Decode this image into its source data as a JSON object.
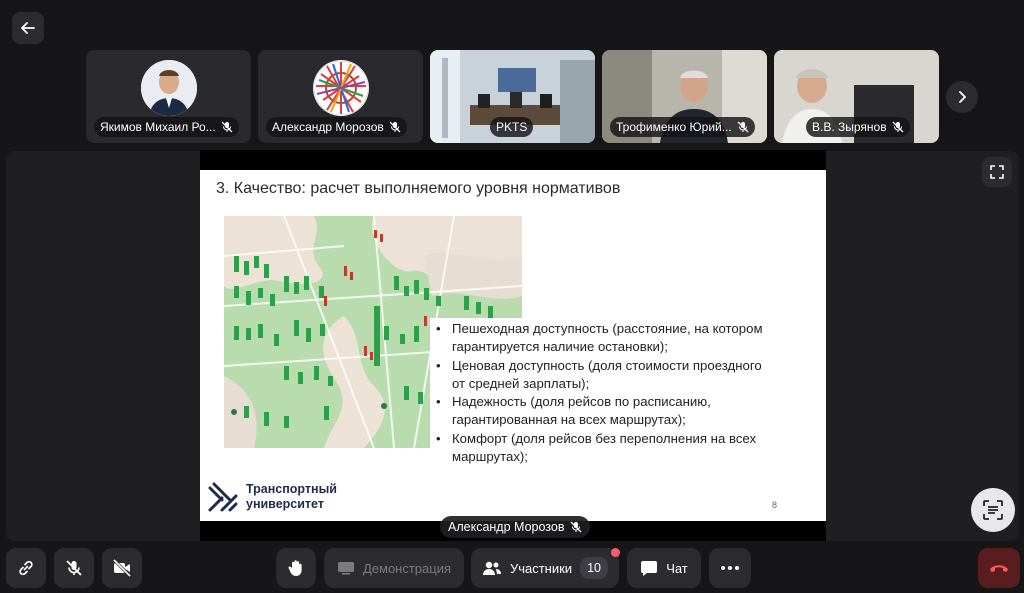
{
  "colors": {
    "background": "#161618",
    "active_border": "#4fd06a",
    "hangup": "#5a1d1f",
    "notification": "#ff5c68"
  },
  "back_button": {
    "icon": "arrow-left-icon"
  },
  "participants": [
    {
      "name": "Якимов Михаил Ро...",
      "muted": true,
      "kind": "avatar-photo"
    },
    {
      "name": "Александр Морозов",
      "muted": true,
      "kind": "avatar-metro-map"
    },
    {
      "name": "PKTS",
      "muted": false,
      "kind": "video",
      "active": true
    },
    {
      "name": "Трофименко Юрий...",
      "muted": true,
      "kind": "video"
    },
    {
      "name": "В.В. Зырянов",
      "muted": true,
      "kind": "video"
    }
  ],
  "next_button": {
    "icon": "chevron-right-icon"
  },
  "slide": {
    "title": "3. Качество: расчет выполняемого уровня нормативов",
    "bullets": [
      "Пешеходная доступность (расстояние, на котором гарантируется наличие остановки);",
      "Ценовая доступность (доля стоимости проездного от средней зарплаты);",
      "Надежность (доля рейсов по расписанию, гарантированная на всех маршрутах);",
      "Комфорт (доля рейсов без переполнения на всех маршрутах);"
    ],
    "logo_line1": "Транспортный",
    "logo_line2": "университет",
    "page_number": "8"
  },
  "speaker_label": "Александр Морозов",
  "controls": {
    "link": "link-icon",
    "mic": "mic-off-icon",
    "camera": "camera-off-icon",
    "hand": "raise-hand-icon",
    "demo_label": "Демонстрация",
    "participants_label": "Участники",
    "participants_count": "10",
    "chat_label": "Чат",
    "more": "more-icon",
    "hangup": "hangup-icon"
  }
}
